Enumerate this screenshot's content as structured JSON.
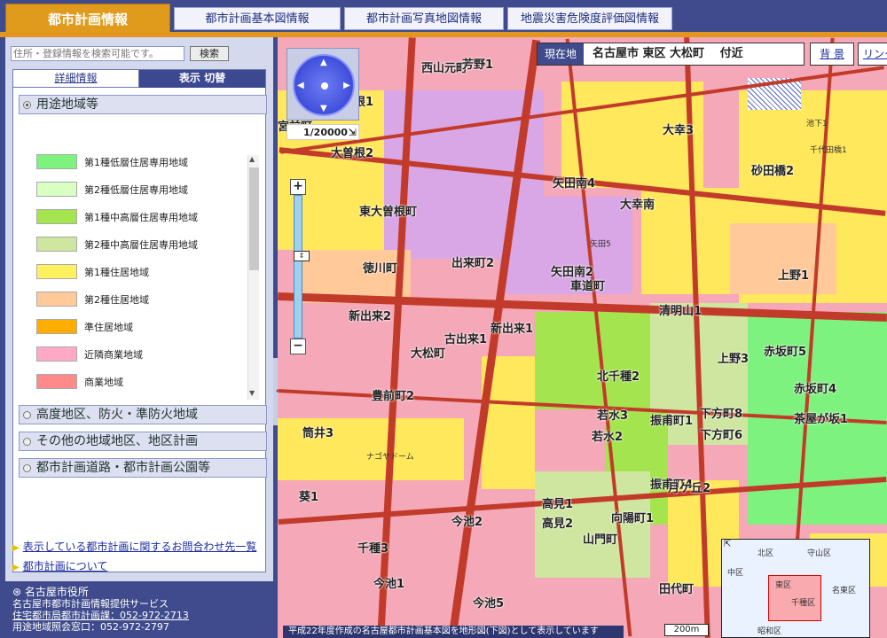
{
  "tabs": [
    {
      "label": "都市計画情報"
    },
    {
      "label": "都市計画基本図情報"
    },
    {
      "label": "都市計画写真地図情報"
    },
    {
      "label": "地震災害危険度評価図情報"
    }
  ],
  "search": {
    "placeholder": "住所・登録情報を検索可能です。",
    "button": "検索"
  },
  "panel": {
    "tab_detail": "詳細情報",
    "tab_toggle": "表示 切替",
    "sections": [
      {
        "label": "用途地域等",
        "selected": true
      },
      {
        "label": "高度地区、防火・準防火地域",
        "selected": false
      },
      {
        "label": "その他の地域地区、地区計画",
        "selected": false
      },
      {
        "label": "都市計画道路・都市計画公園等",
        "selected": false
      }
    ],
    "legend": [
      {
        "label": "第1種低層住居専用地域",
        "color": "#7ef27e"
      },
      {
        "label": "第2種低層住居専用地域",
        "color": "#d9ffc2"
      },
      {
        "label": "第1種中高層住居専用地域",
        "color": "#a4e44e"
      },
      {
        "label": "第2種中高層住居専用地域",
        "color": "#cfe6a0"
      },
      {
        "label": "第1種住居地域",
        "color": "#fff060"
      },
      {
        "label": "第2種住居地域",
        "color": "#ffc99a"
      },
      {
        "label": "準住居地域",
        "color": "#ffae00"
      },
      {
        "label": "近隣商業地域",
        "color": "#ffa9c7"
      },
      {
        "label": "商業地域",
        "color": "#ff8a8a"
      }
    ]
  },
  "links": {
    "inquiry": "表示している都市計画に関するお問合わせ先一覧",
    "about": "都市計画について"
  },
  "footer": {
    "org": "名古屋市役所",
    "service": "名古屋市都市計画情報提供サービス",
    "dept": "住宅都市局都市計画課：052-972-2713",
    "dept2": "用途地域照会窓口：052-972-2797"
  },
  "map": {
    "scale": "1/20000",
    "location_key": "現在地",
    "location_value": "名古屋市 東区 大松町　 付近",
    "background_button": "背 景",
    "link_button": "リンク",
    "notice": "平成22年度作成の名古屋都市計画基本図を地形図(下図)として表示しています",
    "scalebar": "200m",
    "labels": [
      "大曽根2",
      "東大曽根町",
      "出来町2",
      "新出来2",
      "古出来1",
      "大松町",
      "矢田南4",
      "矢田南2",
      "大幸3",
      "大幸南",
      "北千種2",
      "若水3",
      "若水2",
      "振甫町1",
      "振甫町4",
      "上野3",
      "下方町8",
      "下方町6",
      "赤坂町5",
      "赤坂町4",
      "新出来1",
      "筒井3",
      "葵1",
      "今池2",
      "今池1",
      "今池5",
      "千種3",
      "徳川町",
      "池下1",
      "豊前町2",
      "砂田橋2",
      "高見1",
      "高見2",
      "向陽町1",
      "西山元町",
      "山門町",
      "田代町",
      "月ケ丘2",
      "茶屋が坂1",
      "上野1",
      "清明山1",
      "車道町",
      "ナゴヤドーム",
      "矢田5",
      "芳野1",
      "大曽根1",
      "宮前町",
      "千代田橋1"
    ],
    "overview_labels": [
      "北区",
      "守山区",
      "東区",
      "千種区",
      "名東区",
      "中区",
      "昭和区"
    ]
  },
  "colors": {
    "accent": "#e3961f",
    "nav": "#3f4b8c"
  }
}
